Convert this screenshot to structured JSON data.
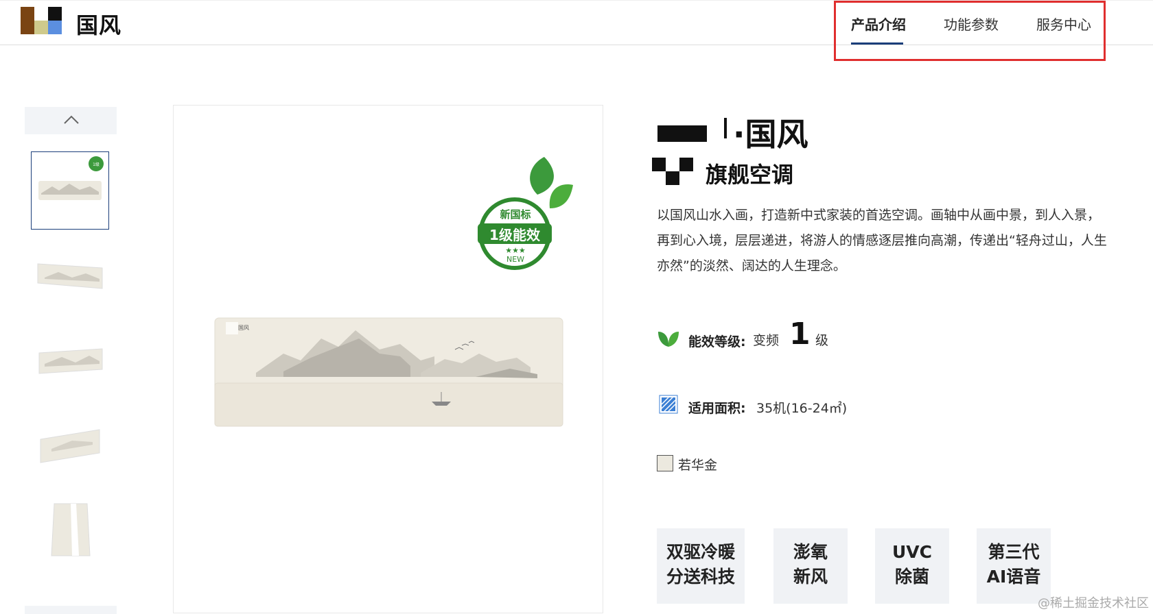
{
  "header": {
    "brand": "国风",
    "nav": [
      {
        "label": "产品介绍",
        "active": true
      },
      {
        "label": "功能参数",
        "active": false
      },
      {
        "label": "服务中心",
        "active": false
      }
    ],
    "highlight_color": "#e02e2e",
    "accent_color": "#1a3e7a"
  },
  "gallery": {
    "up_icon": "chevron-up-icon",
    "thumbnails": [
      {
        "name": "thumb-front-view",
        "selected": true
      },
      {
        "name": "thumb-angle-left",
        "selected": false
      },
      {
        "name": "thumb-angle-right",
        "selected": false
      },
      {
        "name": "thumb-side-view",
        "selected": false
      },
      {
        "name": "thumb-end-view",
        "selected": false
      }
    ],
    "badge": {
      "line1": "新国标",
      "line2": "1级能效",
      "stars": "★★★",
      "line3": "NEW"
    },
    "unit_label": "国风"
  },
  "product": {
    "title": "·国风",
    "subtitle": "旗舰空调",
    "description": "以国风山水入画，打造新中式家装的首选空调。画轴中从画中景，到人入景，再到心入境，层层递进，将游人的情感逐层推向高潮，传递出“轻舟过山，人生亦然”的淡然、阔达的人生理念。",
    "energy": {
      "label": "能效等级:",
      "type": "变频",
      "grade": "1",
      "unit": "级",
      "icon": "leaf-icon"
    },
    "area": {
      "label": "适用面积:",
      "value": "35机(16-24㎡)",
      "icon": "area-icon"
    },
    "color": {
      "name": "若华金",
      "swatch": "#ece9df"
    },
    "features": [
      {
        "line1": "双驱冷暖",
        "line2": "分送科技"
      },
      {
        "line1": "澎氧",
        "line2": "新风"
      },
      {
        "line1": "UVC",
        "line2": "除菌"
      },
      {
        "line1": "第三代",
        "line2": "AI语音"
      }
    ]
  },
  "watermark": "@稀土掘金技术社区"
}
